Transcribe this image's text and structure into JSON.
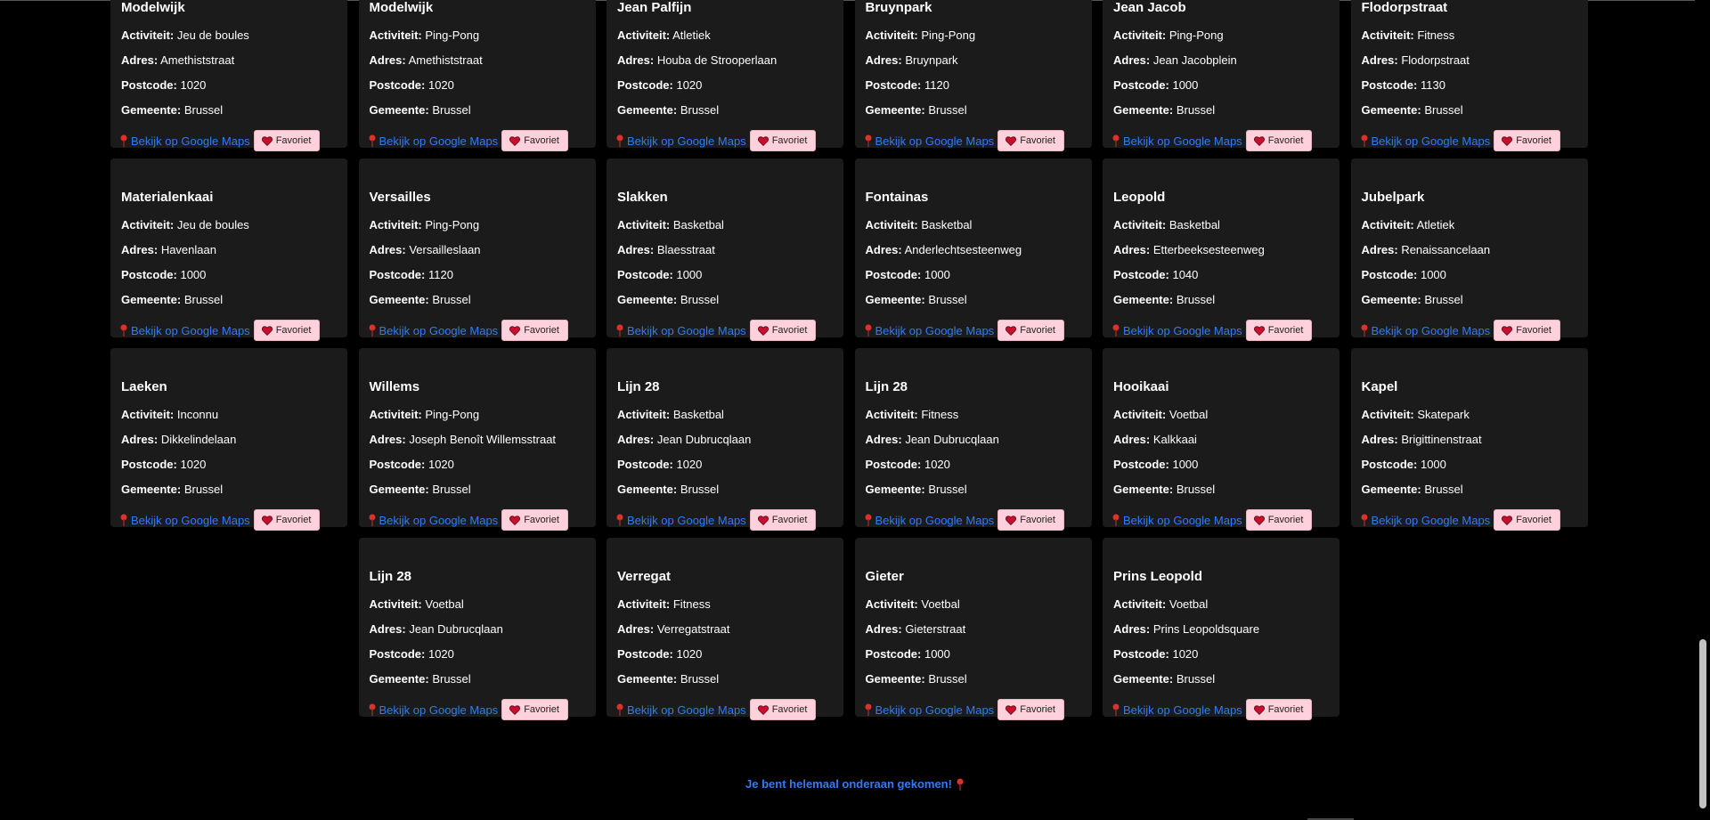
{
  "labels": {
    "activity": "Activiteit:",
    "address": "Adres:",
    "postcode": "Postcode:",
    "municipality": "Gemeente:",
    "maps_link": "Bekijk op Google Maps",
    "favorite_button": "Favoriet"
  },
  "cards": [
    {
      "name": "Modelwijk",
      "activity": "Jeu de boules",
      "address": "Amethiststraat",
      "postcode": "1020",
      "municipality": "Brussel"
    },
    {
      "name": "Modelwijk",
      "activity": "Ping-Pong",
      "address": "Amethiststraat",
      "postcode": "1020",
      "municipality": "Brussel"
    },
    {
      "name": "Jean Palfijn",
      "activity": "Atletiek",
      "address": "Houba de Strooperlaan",
      "postcode": "1020",
      "municipality": "Brussel"
    },
    {
      "name": "Bruynpark",
      "activity": "Ping-Pong",
      "address": "Bruynpark",
      "postcode": "1120",
      "municipality": "Brussel"
    },
    {
      "name": "Jean Jacob",
      "activity": "Ping-Pong",
      "address": "Jean Jacobplein",
      "postcode": "1000",
      "municipality": "Brussel"
    },
    {
      "name": "Flodorpstraat",
      "activity": "Fitness",
      "address": "Flodorpstraat",
      "postcode": "1130",
      "municipality": "Brussel"
    },
    {
      "name": "Materialenkaai",
      "activity": "Jeu de boules",
      "address": "Havenlaan",
      "postcode": "1000",
      "municipality": "Brussel"
    },
    {
      "name": "Versailles",
      "activity": "Ping-Pong",
      "address": "Versailleslaan",
      "postcode": "1120",
      "municipality": "Brussel"
    },
    {
      "name": "Slakken",
      "activity": "Basketbal",
      "address": "Blaesstraat",
      "postcode": "1000",
      "municipality": "Brussel"
    },
    {
      "name": "Fontainas",
      "activity": "Basketbal",
      "address": "Anderlechtsesteenweg",
      "postcode": "1000",
      "municipality": "Brussel"
    },
    {
      "name": "Leopold",
      "activity": "Basketbal",
      "address": "Etterbeeksesteenweg",
      "postcode": "1040",
      "municipality": "Brussel"
    },
    {
      "name": "Jubelpark",
      "activity": "Atletiek",
      "address": "Renaissancelaan",
      "postcode": "1000",
      "municipality": "Brussel"
    },
    {
      "name": "Laeken",
      "activity": "Inconnu",
      "address": "Dikkelindelaan",
      "postcode": "1020",
      "municipality": "Brussel"
    },
    {
      "name": "Willems",
      "activity": "Ping-Pong",
      "address": "Joseph Benoît Willemsstraat",
      "postcode": "1020",
      "municipality": "Brussel"
    },
    {
      "name": "Lijn 28",
      "activity": "Basketbal",
      "address": "Jean Dubrucqlaan",
      "postcode": "1020",
      "municipality": "Brussel"
    },
    {
      "name": "Lijn 28",
      "activity": "Fitness",
      "address": "Jean Dubrucqlaan",
      "postcode": "1020",
      "municipality": "Brussel"
    },
    {
      "name": "Hooikaai",
      "activity": "Voetbal",
      "address": "Kalkkaai",
      "postcode": "1000",
      "municipality": "Brussel"
    },
    {
      "name": "Kapel",
      "activity": "Skatepark",
      "address": "Brigittinenstraat",
      "postcode": "1000",
      "municipality": "Brussel"
    },
    {
      "name": "Lijn 28",
      "activity": "Voetbal",
      "address": "Jean Dubrucqlaan",
      "postcode": "1020",
      "municipality": "Brussel"
    },
    {
      "name": "Verregat",
      "activity": "Fitness",
      "address": "Verregatstraat",
      "postcode": "1020",
      "municipality": "Brussel"
    },
    {
      "name": "Gieter",
      "activity": "Voetbal",
      "address": "Gieterstraat",
      "postcode": "1000",
      "municipality": "Brussel"
    },
    {
      "name": "Prins Leopold",
      "activity": "Voetbal",
      "address": "Prins Leopoldsquare",
      "postcode": "1020",
      "municipality": "Brussel"
    }
  ],
  "footer": {
    "message": "Je bent helemaal onderaan gekomen!"
  },
  "icons": {
    "pin": "map-pin-icon",
    "heart": "heart-icon"
  },
  "colors": {
    "background": "#000000",
    "card": "#1b1b1b",
    "link": "#2f7cf6",
    "favorite_bg": "#ffd1dc",
    "heart": "#c8102e",
    "pin": "#e0302a"
  }
}
